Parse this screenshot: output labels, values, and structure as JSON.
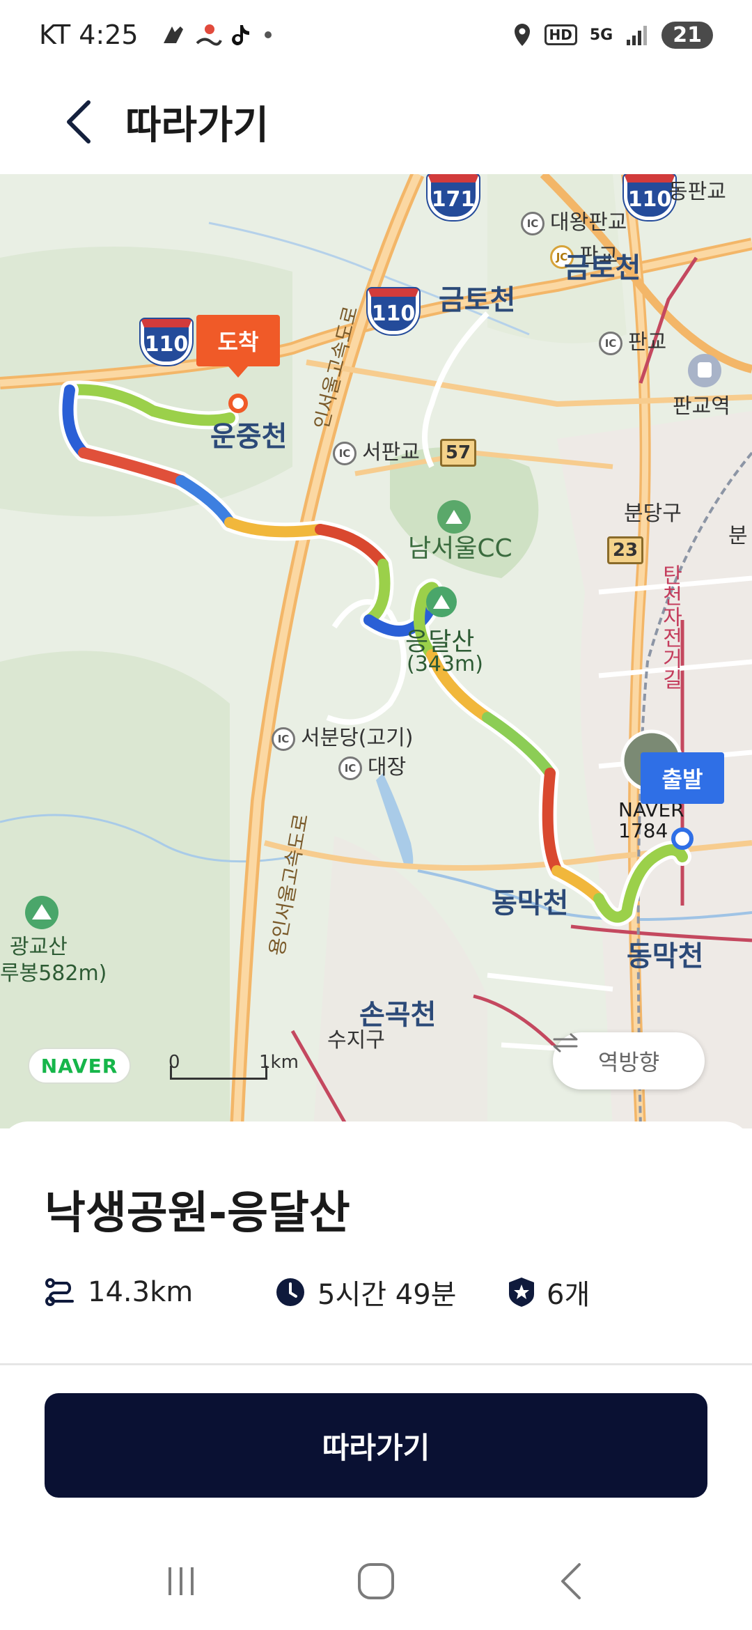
{
  "status_bar": {
    "carrier_time": "KT 4:25",
    "battery": "21",
    "hd": "HD",
    "network": "5G",
    "icons": [
      "app-icon",
      "map-pin-app-icon",
      "tiktok-icon",
      "dot-icon",
      "location-icon",
      "signal-icon"
    ]
  },
  "header": {
    "title": "따라가기",
    "back_icon": "chevron-left-icon"
  },
  "map": {
    "arrive_label": "도착",
    "start_label": "출발",
    "naver_logo": "NAVER",
    "scale_zero": "0",
    "scale_unit": "1km",
    "reverse_label": "역방향",
    "labels": {
      "dongpangyo": "동판교",
      "daewangpangyo": "대왕판교",
      "pangyo_jc": "판교",
      "geumtocheon_top": "금토천",
      "geumtocheon": "금토천",
      "pangyo_ic": "판교",
      "pangyo_station": "판교역",
      "unjungcheon": "운중천",
      "seopangyo": "서판교",
      "namseoul_cc": "남서울CC",
      "bundang_gu": "분당구",
      "bun": "분",
      "tancheon_bike": "탄천자전거길",
      "mountain": "응달산",
      "mountain_height": "(343m)",
      "seobundang": "서분당(고기)",
      "daejang": "대장",
      "naver_1784": "NAVER 1784",
      "dongmakcheon_left": "동막천",
      "dongmakcheon_right": "동막천",
      "gwanggyosan": "광교산",
      "gwanggyosan_peak": "루봉582m)",
      "songokcheon": "손곡천",
      "suji_gu": "수지구",
      "yongin_seoul_exp_top": "인서울고속도로",
      "yongin_seoul_exp_bottom": "용인서울고속도로"
    },
    "highways": [
      "171",
      "110",
      "110",
      "110"
    ],
    "routes": [
      "57",
      "23"
    ],
    "ic_badge": "IC",
    "jc_badge": "JC"
  },
  "course": {
    "name": "낙생공원-응달산",
    "distance": "14.3km",
    "duration": "5시간 49분",
    "stamps": "6개",
    "distance_icon": "route-icon",
    "duration_icon": "clock-icon",
    "stamps_icon": "star-badge-icon"
  },
  "actions": {
    "follow_label": "따라가기"
  },
  "nav": {
    "recents_icon": "recents-icon",
    "home_icon": "home-icon",
    "back_icon": "back-icon"
  },
  "colors": {
    "primary": "#0a1133",
    "arrive": "#f05a28",
    "start": "#2f6fe6",
    "naver_green": "#16b64a"
  }
}
